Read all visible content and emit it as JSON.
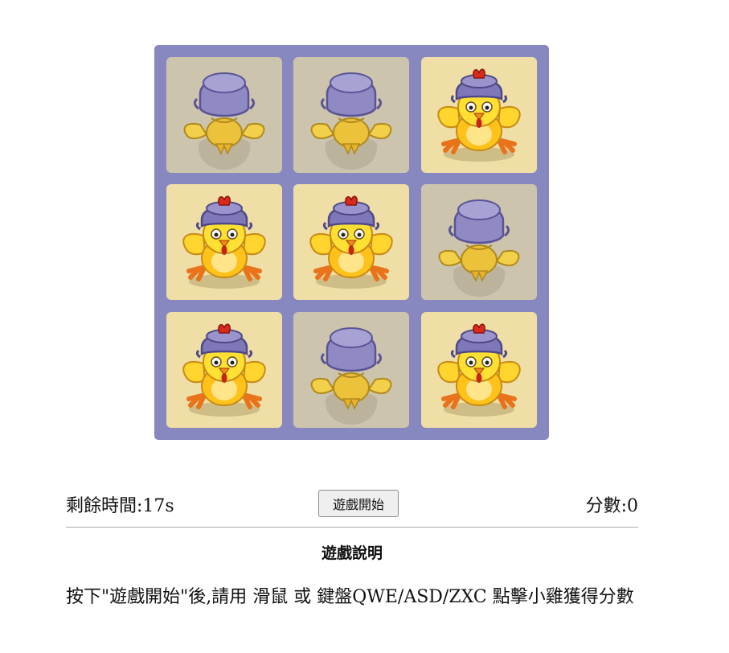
{
  "board": {
    "background": "#8888c0",
    "cells": [
      {
        "key": "Q",
        "state": "hidden",
        "icon": "chick-hiding-under-pot-icon"
      },
      {
        "key": "W",
        "state": "hidden",
        "icon": "chick-hiding-under-pot-icon"
      },
      {
        "key": "E",
        "state": "visible",
        "icon": "chick-with-pot-helmet-icon"
      },
      {
        "key": "A",
        "state": "visible",
        "icon": "chick-with-pot-helmet-icon"
      },
      {
        "key": "S",
        "state": "visible",
        "icon": "chick-with-pot-helmet-icon"
      },
      {
        "key": "D",
        "state": "hidden",
        "icon": "chick-hiding-under-pot-icon"
      },
      {
        "key": "Z",
        "state": "visible",
        "icon": "chick-with-pot-helmet-icon"
      },
      {
        "key": "X",
        "state": "hidden",
        "icon": "chick-hiding-under-pot-icon"
      },
      {
        "key": "C",
        "state": "visible",
        "icon": "chick-with-pot-helmet-icon"
      }
    ],
    "colors": {
      "visible_tile": "#efdea6",
      "hidden_tile": "#ccc4ad"
    }
  },
  "status": {
    "timer_label": "剩餘時間:17s",
    "start_button": "遊戲開始",
    "score_label": "分數:0"
  },
  "instructions": {
    "title": "遊戲說明",
    "text": "按下\"遊戲開始\"後,請用 滑鼠 或 鍵盤QWE/ASD/ZXC 點擊小雞獲得分數"
  }
}
